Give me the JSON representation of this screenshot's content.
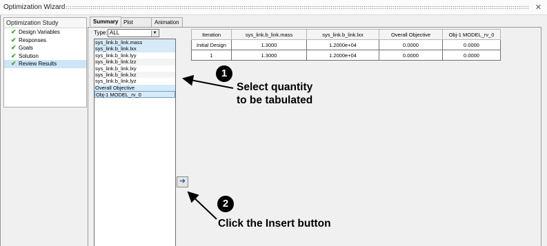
{
  "window": {
    "title": "Optimization Wizard",
    "close_glyph": "✕"
  },
  "study": {
    "header": "Optimization Study",
    "items": [
      {
        "label": "Design Variables",
        "checked": true,
        "selected": false
      },
      {
        "label": "Responses",
        "checked": true,
        "selected": false
      },
      {
        "label": "Goals",
        "checked": true,
        "selected": false
      },
      {
        "label": "Solution",
        "checked": true,
        "selected": false
      },
      {
        "label": "Review Results",
        "checked": true,
        "selected": true
      }
    ]
  },
  "tabs": {
    "summary": "Summary",
    "plot": "Plot",
    "animation": "Animation",
    "active": "Summary"
  },
  "type_filter": {
    "label": "Type:",
    "value": "ALL"
  },
  "quantities": [
    "sys_link.b_link.mass",
    "sys_link.b_link.lxx",
    "sys_link.b_link.lyy",
    "sys_link.b_link.lzz",
    "sys_link.b_link.lxy",
    "sys_link.b_link.lxz",
    "sys_link.b_link.lyz",
    "Overall Objective",
    "Obj-1 MODEL_rv_0"
  ],
  "insert_button": {
    "icon": "insert-arrow-icon",
    "glyph": "➜"
  },
  "table": {
    "columns": [
      "Iteration",
      "sys_link.b_link.mass",
      "sys_link.b_link.lxx",
      "Overall Objective",
      "Obj-1 MODEL_rv_0"
    ],
    "rows": [
      [
        "Initial Design",
        "1.3000",
        "1.2000e+04",
        "0.0000",
        "0.0000"
      ],
      [
        "1",
        "1.3000",
        "1.2000e+04",
        "0.0000",
        "0.0000"
      ]
    ]
  },
  "callouts": [
    {
      "number": "1",
      "text_line1": "Select quantity",
      "text_line2": "to be tabulated"
    },
    {
      "number": "2",
      "text_line1": "Click the Insert button"
    }
  ],
  "colors": {
    "check": "#3aa12d",
    "selection": "#cde5f7",
    "arrow_icon": "#2d5fa8"
  }
}
